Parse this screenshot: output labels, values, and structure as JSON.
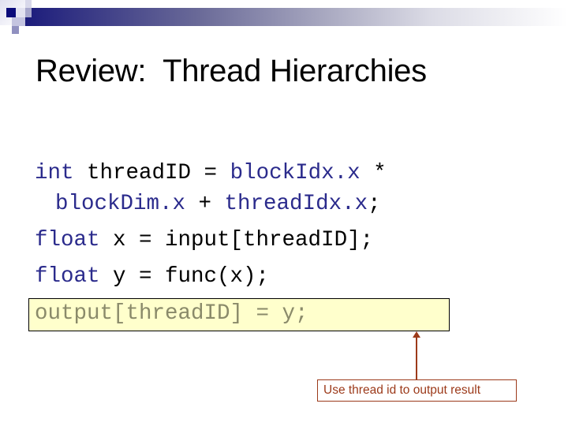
{
  "slide": {
    "title": "Review:  Thread Hierarchies",
    "code": {
      "line1": {
        "kw1": "int",
        "text1": " threadID = ",
        "kw2": "blockIdx.x",
        "text2": " *"
      },
      "line2": {
        "kw1": "blockDim.x",
        "text1": " + ",
        "kw2": "threadIdx.x",
        "text2": ";"
      },
      "line3": {
        "kw1": "float",
        "text1": " x = input[threadID];"
      },
      "line4": {
        "kw1": "float",
        "text1": " y = func(x);"
      },
      "line5": {
        "text": "output[threadID] = y;"
      }
    },
    "callout": {
      "text": "Use thread id to output result"
    }
  },
  "colors": {
    "keyword": "#2b2b8c",
    "highlight_bg": "#ffffcc",
    "callout": "#9c3a1a",
    "header_dark": "#0b0b7a"
  }
}
